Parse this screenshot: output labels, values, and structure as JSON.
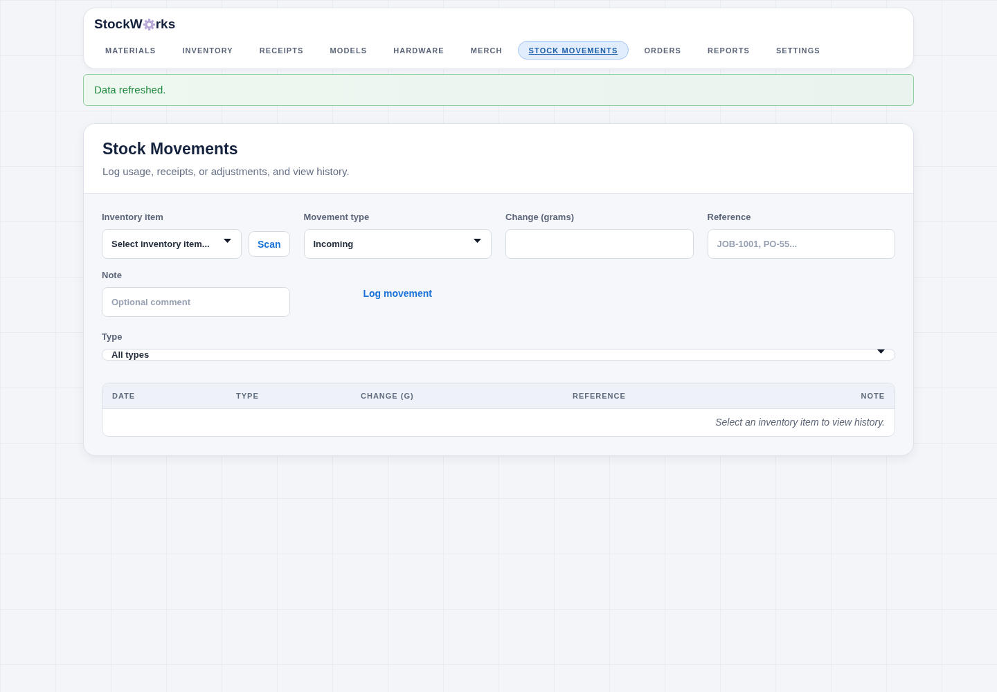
{
  "logo": {
    "text_start": "StockW",
    "text_end": "rks"
  },
  "nav": [
    {
      "label": "MATERIALS",
      "selected": false
    },
    {
      "label": "INVENTORY",
      "selected": false
    },
    {
      "label": "RECEIPTS",
      "selected": false
    },
    {
      "label": "MODELS",
      "selected": false
    },
    {
      "label": "HARDWARE",
      "selected": false
    },
    {
      "label": "MERCH",
      "selected": false
    },
    {
      "label": "STOCK MOVEMENTS",
      "selected": true
    },
    {
      "label": "ORDERS",
      "selected": false
    },
    {
      "label": "REPORTS",
      "selected": false
    },
    {
      "label": "SETTINGS",
      "selected": false
    }
  ],
  "alert": {
    "kind": "success",
    "text": "Data refreshed."
  },
  "page": {
    "title": "Stock Movements",
    "subtitle": "Log usage, receipts, or adjustments, and view history."
  },
  "form": {
    "inventory_item": {
      "label": "Inventory item",
      "value": "Select inventory item...",
      "scan_button": "Scan"
    },
    "movement_type": {
      "label": "Movement type",
      "value": "Incoming"
    },
    "change": {
      "label": "Change (grams)"
    },
    "reference": {
      "label": "Reference",
      "placeholder": "JOB-1001, PO-55..."
    },
    "note": {
      "label": "Note",
      "placeholder": "Optional comment"
    },
    "submit_button": "Log movement"
  },
  "filter": {
    "label": "Type",
    "value": "All types"
  },
  "table": {
    "columns": [
      "DATE",
      "TYPE",
      "CHANGE (G)",
      "REFERENCE",
      "NOTE"
    ],
    "empty_message": "Select an inventory item to view history."
  }
}
